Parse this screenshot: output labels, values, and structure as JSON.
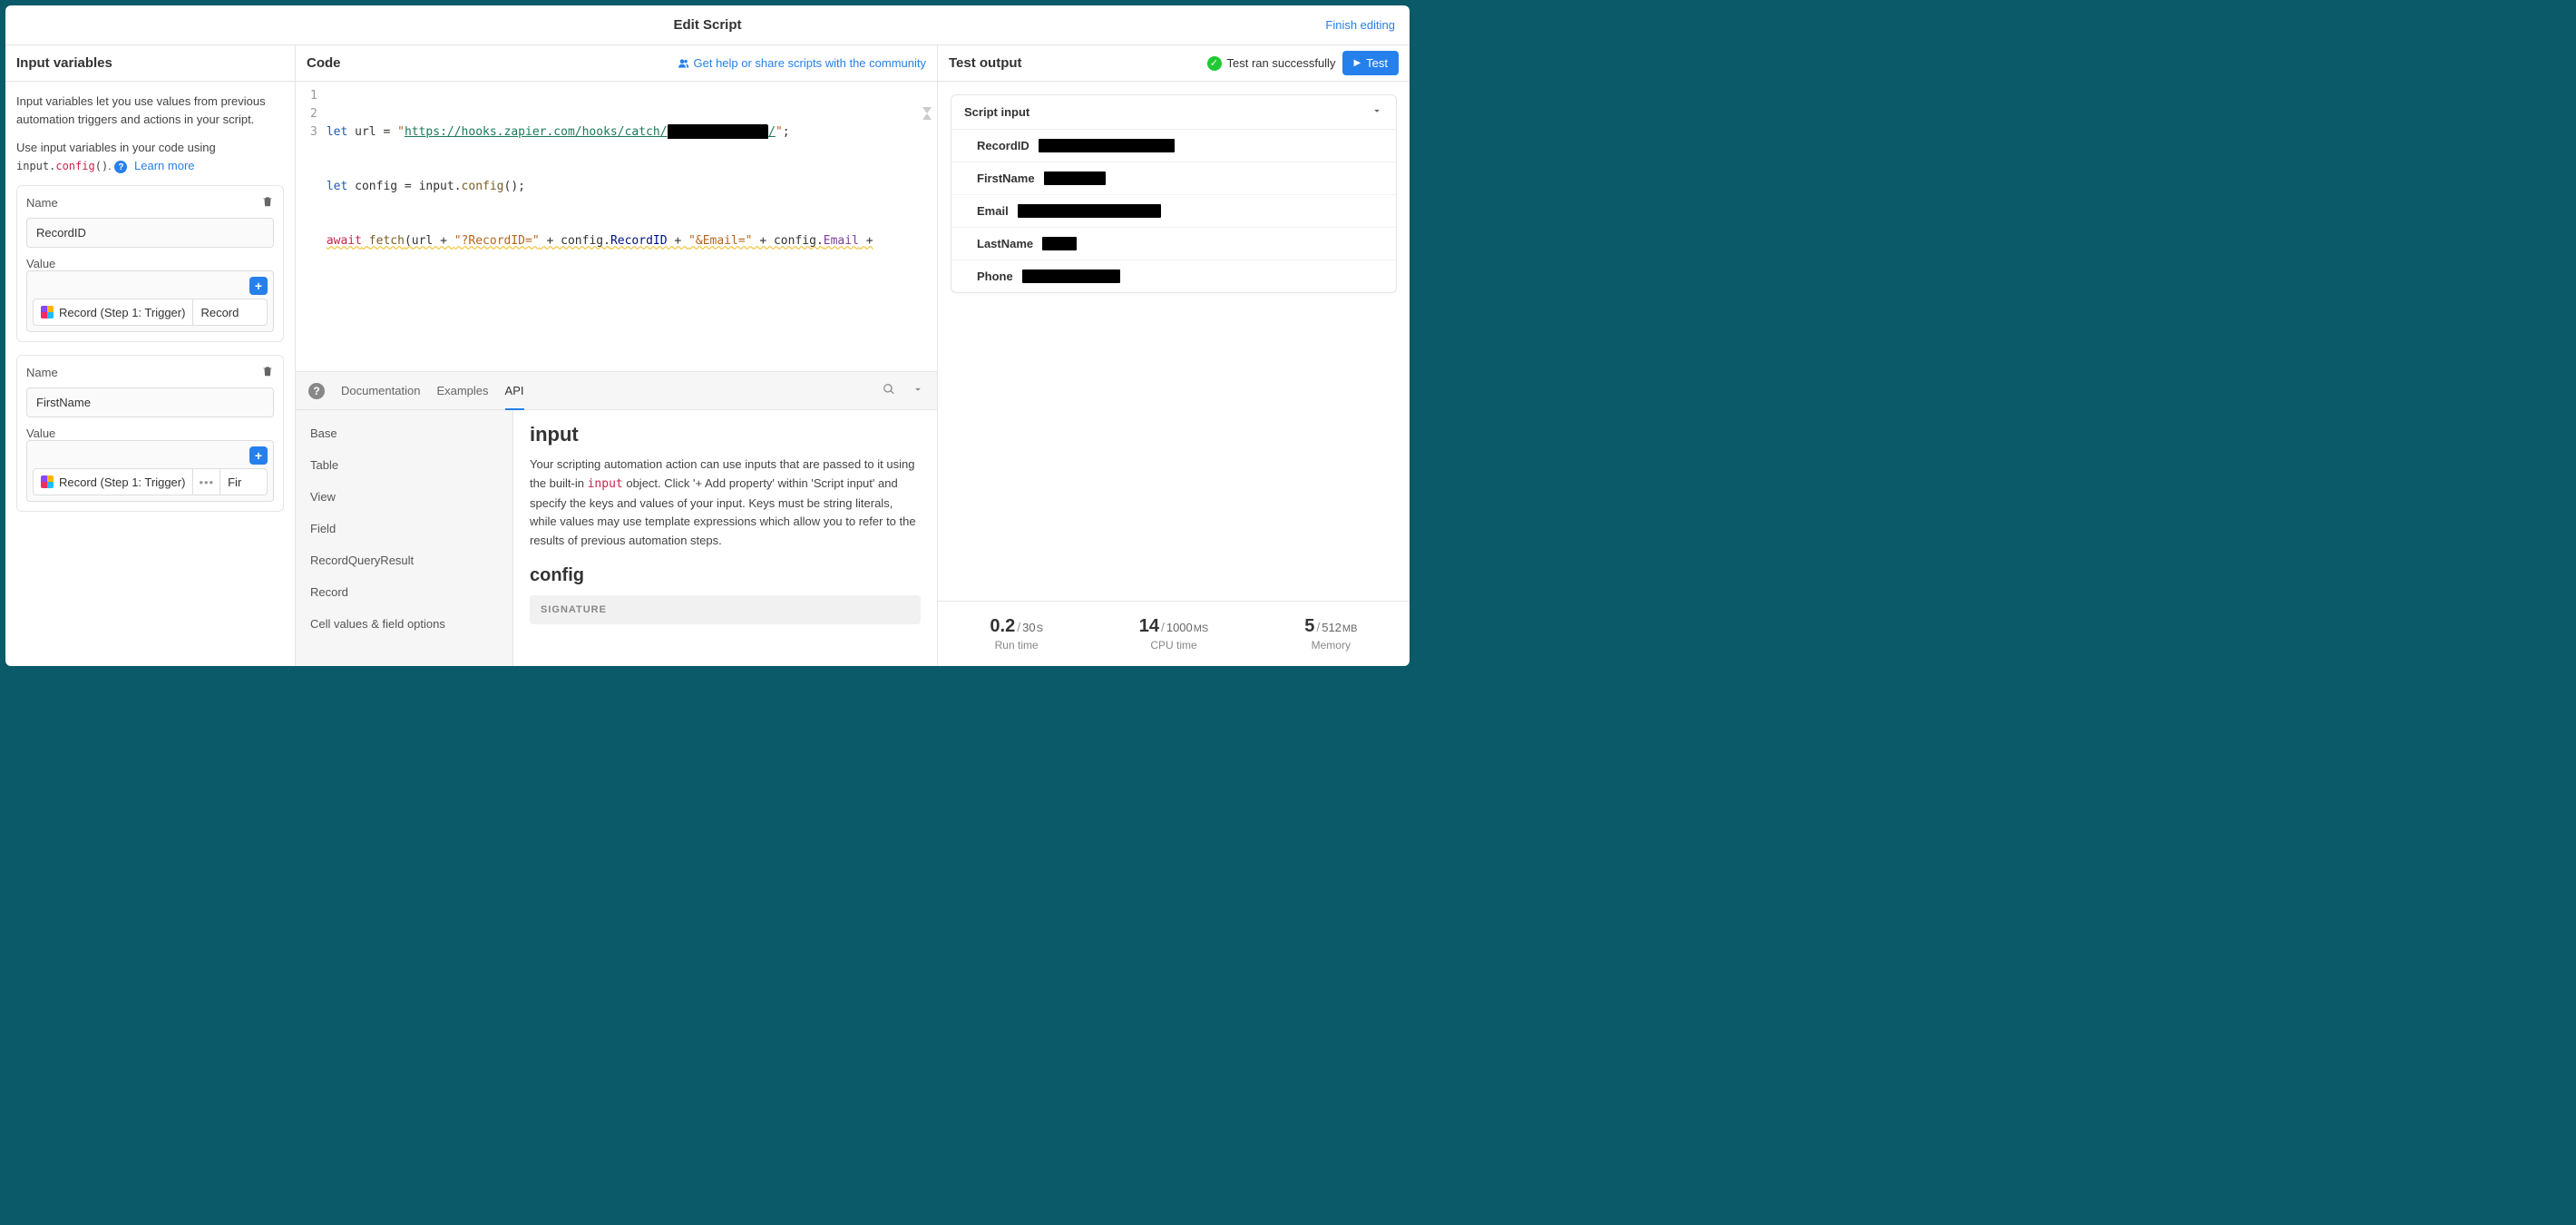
{
  "title": "Edit Script",
  "finish_label": "Finish editing",
  "left": {
    "header": "Input variables",
    "desc1": "Input variables let you use values from previous automation triggers and actions in your script.",
    "desc2_prefix": "Use input variables in your code using ",
    "desc2_code_a": "input.",
    "desc2_code_b": "config",
    "desc2_code_c": "()",
    "learn_more": "Learn more",
    "vars": [
      {
        "name_label": "Name",
        "name_value": "RecordID",
        "value_label": "Value",
        "tokens": [
          "Record (Step 1: Trigger)",
          "Record"
        ],
        "has_dots": false
      },
      {
        "name_label": "Name",
        "name_value": "FirstName",
        "value_label": "Value",
        "tokens": [
          "Record (Step 1: Trigger)",
          "Fir"
        ],
        "has_dots": true
      }
    ]
  },
  "center": {
    "header": "Code",
    "help_link": "Get help or share scripts with the community",
    "code": {
      "line1": {
        "kw": "let",
        "ident": " url = ",
        "q1": "\"",
        "url": "https://hooks.zapier.com/hooks/catch/",
        "redact": "██████████████",
        "tail": "/",
        "q2": "\"",
        "semi": ";"
      },
      "line2": {
        "kw": "let",
        "rest": " config = input.",
        "fn": "config",
        "call": "();"
      },
      "line3": {
        "await": "await",
        "sp": " ",
        "fn": "fetch",
        "open": "(",
        "arg1": "url + ",
        "s1": "\"?RecordID=\"",
        "plus1": " + config.",
        "p1": "RecordID",
        "plus2": " + ",
        "s2": "\"&Email=\"",
        "plus3": " + config.",
        "p2": "Email",
        "tail": " +"
      },
      "gutter": [
        "1",
        "2",
        "3"
      ]
    },
    "docs": {
      "tabs": [
        "Documentation",
        "Examples",
        "API"
      ],
      "active_tab": "API",
      "side_items": [
        "Base",
        "Table",
        "View",
        "Field",
        "RecordQueryResult",
        "Record",
        "Cell values & field options"
      ],
      "h2": "input",
      "para_a": "Your scripting automation action can use inputs that are passed to it using the built-in ",
      "para_code": "input",
      "para_b": " object. Click '+ Add property' within 'Script input' and specify the keys and values of your input. Keys must be string literals, while values may use template expressions which allow you to refer to the results of previous automation steps.",
      "h3": "config",
      "signature_label": "SIGNATURE"
    }
  },
  "right": {
    "header": "Test output",
    "status_text": "Test ran successfully",
    "test_label": "Test",
    "script_input_header": "Script input",
    "inputs": [
      {
        "key": "RecordID",
        "width": 150
      },
      {
        "key": "FirstName",
        "width": 68
      },
      {
        "key": "Email",
        "width": 158
      },
      {
        "key": "LastName",
        "width": 38
      },
      {
        "key": "Phone",
        "width": 108
      }
    ],
    "metrics": [
      {
        "value": "0.2",
        "limit": "30",
        "unit": "S",
        "caption": "Run time"
      },
      {
        "value": "14",
        "limit": "1000",
        "unit": "MS",
        "caption": "CPU time"
      },
      {
        "value": "5",
        "limit": "512",
        "unit": "MB",
        "caption": "Memory"
      }
    ]
  }
}
